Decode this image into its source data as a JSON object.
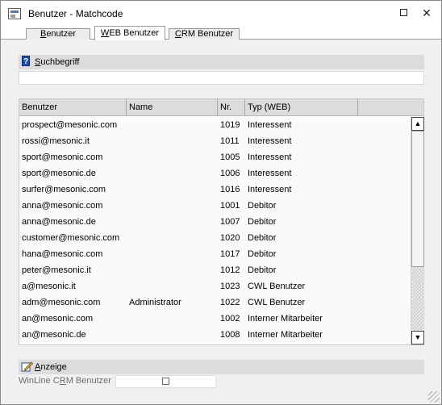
{
  "window": {
    "title": "Benutzer - Matchcode",
    "maximize_icon": "maximize-icon",
    "close_glyph": "✕"
  },
  "tabs": [
    {
      "label": "Benutzer",
      "mnemonic": "B",
      "rest": "enutzer",
      "active": false
    },
    {
      "label": "WEB Benutzer",
      "mnemonic": "W",
      "rest": "EB Benutzer",
      "active": true
    },
    {
      "label": "CRM Benutzer",
      "mnemonic": "C",
      "rest": "RM Benutzer",
      "active": false
    }
  ],
  "search": {
    "heading_mnemonic": "S",
    "heading_rest": "uchbegriff",
    "heading": "Suchbegriff",
    "value": "",
    "icon": "help-icon"
  },
  "grid": {
    "columns": [
      "Benutzer",
      "Name",
      "Nr.",
      "Typ (WEB)"
    ],
    "rows": [
      {
        "user": "prospect@mesonic.com",
        "name": "",
        "nr": "1019",
        "typ": "Interessent"
      },
      {
        "user": "rossi@mesonic.it",
        "name": "",
        "nr": "1011",
        "typ": "Interessent"
      },
      {
        "user": "sport@mesonic.com",
        "name": "",
        "nr": "1005",
        "typ": "Interessent"
      },
      {
        "user": "sport@mesonic.de",
        "name": "",
        "nr": "1006",
        "typ": "Interessent"
      },
      {
        "user": "surfer@mesonic.com",
        "name": "",
        "nr": "1016",
        "typ": "Interessent"
      },
      {
        "user": "anna@mesonic.com",
        "name": "",
        "nr": "1001",
        "typ": "Debitor"
      },
      {
        "user": "anna@mesonic.de",
        "name": "",
        "nr": "1007",
        "typ": "Debitor"
      },
      {
        "user": "customer@mesonic.com",
        "name": "",
        "nr": "1020",
        "typ": "Debitor"
      },
      {
        "user": "hana@mesonic.com",
        "name": "",
        "nr": "1017",
        "typ": "Debitor"
      },
      {
        "user": "peter@mesonic.it",
        "name": "",
        "nr": "1012",
        "typ": "Debitor"
      },
      {
        "user": "a@mesonic.it",
        "name": "",
        "nr": "1023",
        "typ": "CWL Benutzer"
      },
      {
        "user": "adm@mesonic.com",
        "name": "Administrator",
        "nr": "1022",
        "typ": "CWL Benutzer"
      },
      {
        "user": "an@mesonic.com",
        "name": "",
        "nr": "1002",
        "typ": "Interner Mitarbeiter"
      },
      {
        "user": "an@mesonic.de",
        "name": "",
        "nr": "1008",
        "typ": "Interner Mitarbeiter"
      }
    ],
    "scroll_up_glyph": "▲",
    "scroll_down_glyph": "▼"
  },
  "display": {
    "heading": "Anzeige",
    "heading_mnemonic": "A",
    "heading_rest": "nzeige",
    "icon": "edit-icon",
    "field_label_pre": "WinLine C",
    "field_label_mnemonic": "R",
    "field_label_post": "M Benutzer",
    "field_label": "WinLine CRM Benutzer",
    "checked": false
  }
}
